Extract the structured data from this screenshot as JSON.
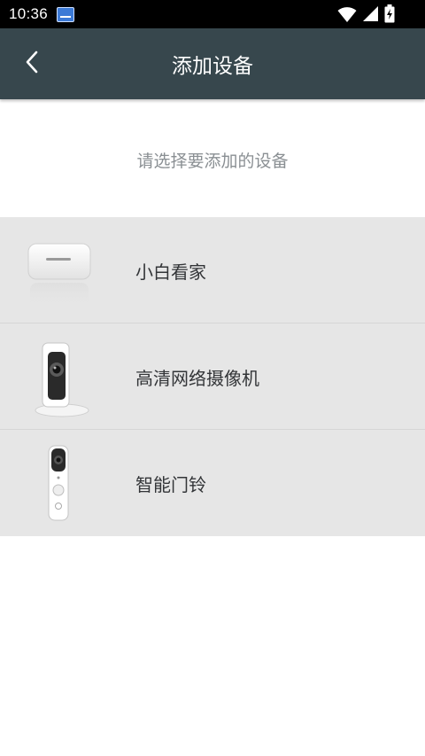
{
  "status_bar": {
    "time": "10:36",
    "notification_icon": "message-icon",
    "icons": [
      "wifi-icon",
      "cell-signal-icon",
      "battery-charging-icon"
    ]
  },
  "header": {
    "back_icon": "chevron-left-icon",
    "title": "添加设备",
    "background_color": "#37474d"
  },
  "main": {
    "subtitle": "请选择要添加的设备",
    "devices": [
      {
        "label": "小白看家",
        "icon": "home-hub-icon"
      },
      {
        "label": "高清网络摄像机",
        "icon": "hd-camera-icon"
      },
      {
        "label": "智能门铃",
        "icon": "doorbell-icon"
      }
    ]
  }
}
